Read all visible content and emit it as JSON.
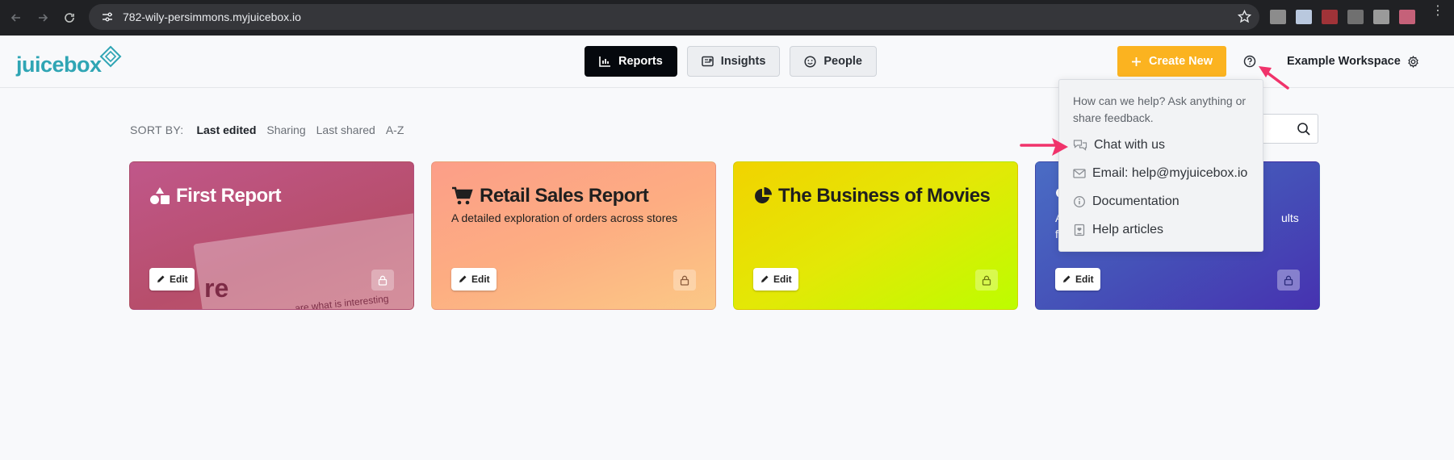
{
  "browser": {
    "url": "782-wily-persimmons.myjuicebox.io",
    "extension_colors": [
      "#8c8c8c",
      "#b9c8de",
      "#a03338",
      "#707070",
      "#9a9a9a",
      "#c56179"
    ]
  },
  "app": {
    "logo": "juicebox",
    "nav": {
      "reports": "Reports",
      "insights": "Insights",
      "people": "People"
    },
    "create_label": "Create New",
    "workspace": "Example Workspace"
  },
  "sort": {
    "label": "SORT BY:",
    "options": [
      "Last edited",
      "Sharing",
      "Last shared",
      "A-Z"
    ],
    "selected": "Last edited"
  },
  "cards": [
    {
      "title": "First Report",
      "description": "",
      "edit": "Edit",
      "preview_big": "re",
      "preview_small": "are what is interesting"
    },
    {
      "title": "Retail Sales Report",
      "description": "A detailed exploration of orders across stores",
      "edit": "Edit"
    },
    {
      "title": "The Business of Movies",
      "description": "",
      "edit": "Edit"
    },
    {
      "title": "",
      "description_start": "A",
      "description_end": "ults",
      "description_line2": "f",
      "edit": "Edit"
    }
  ],
  "help_menu": {
    "intro": "How can we help? Ask anything or share feedback.",
    "items": [
      "Chat with us",
      "Email: help@myjuicebox.io",
      "Documentation",
      "Help articles"
    ]
  },
  "colors": {
    "accent": "#fbb320",
    "brand": "#2fa5b4",
    "annotation_arrow": "#f0336b"
  }
}
